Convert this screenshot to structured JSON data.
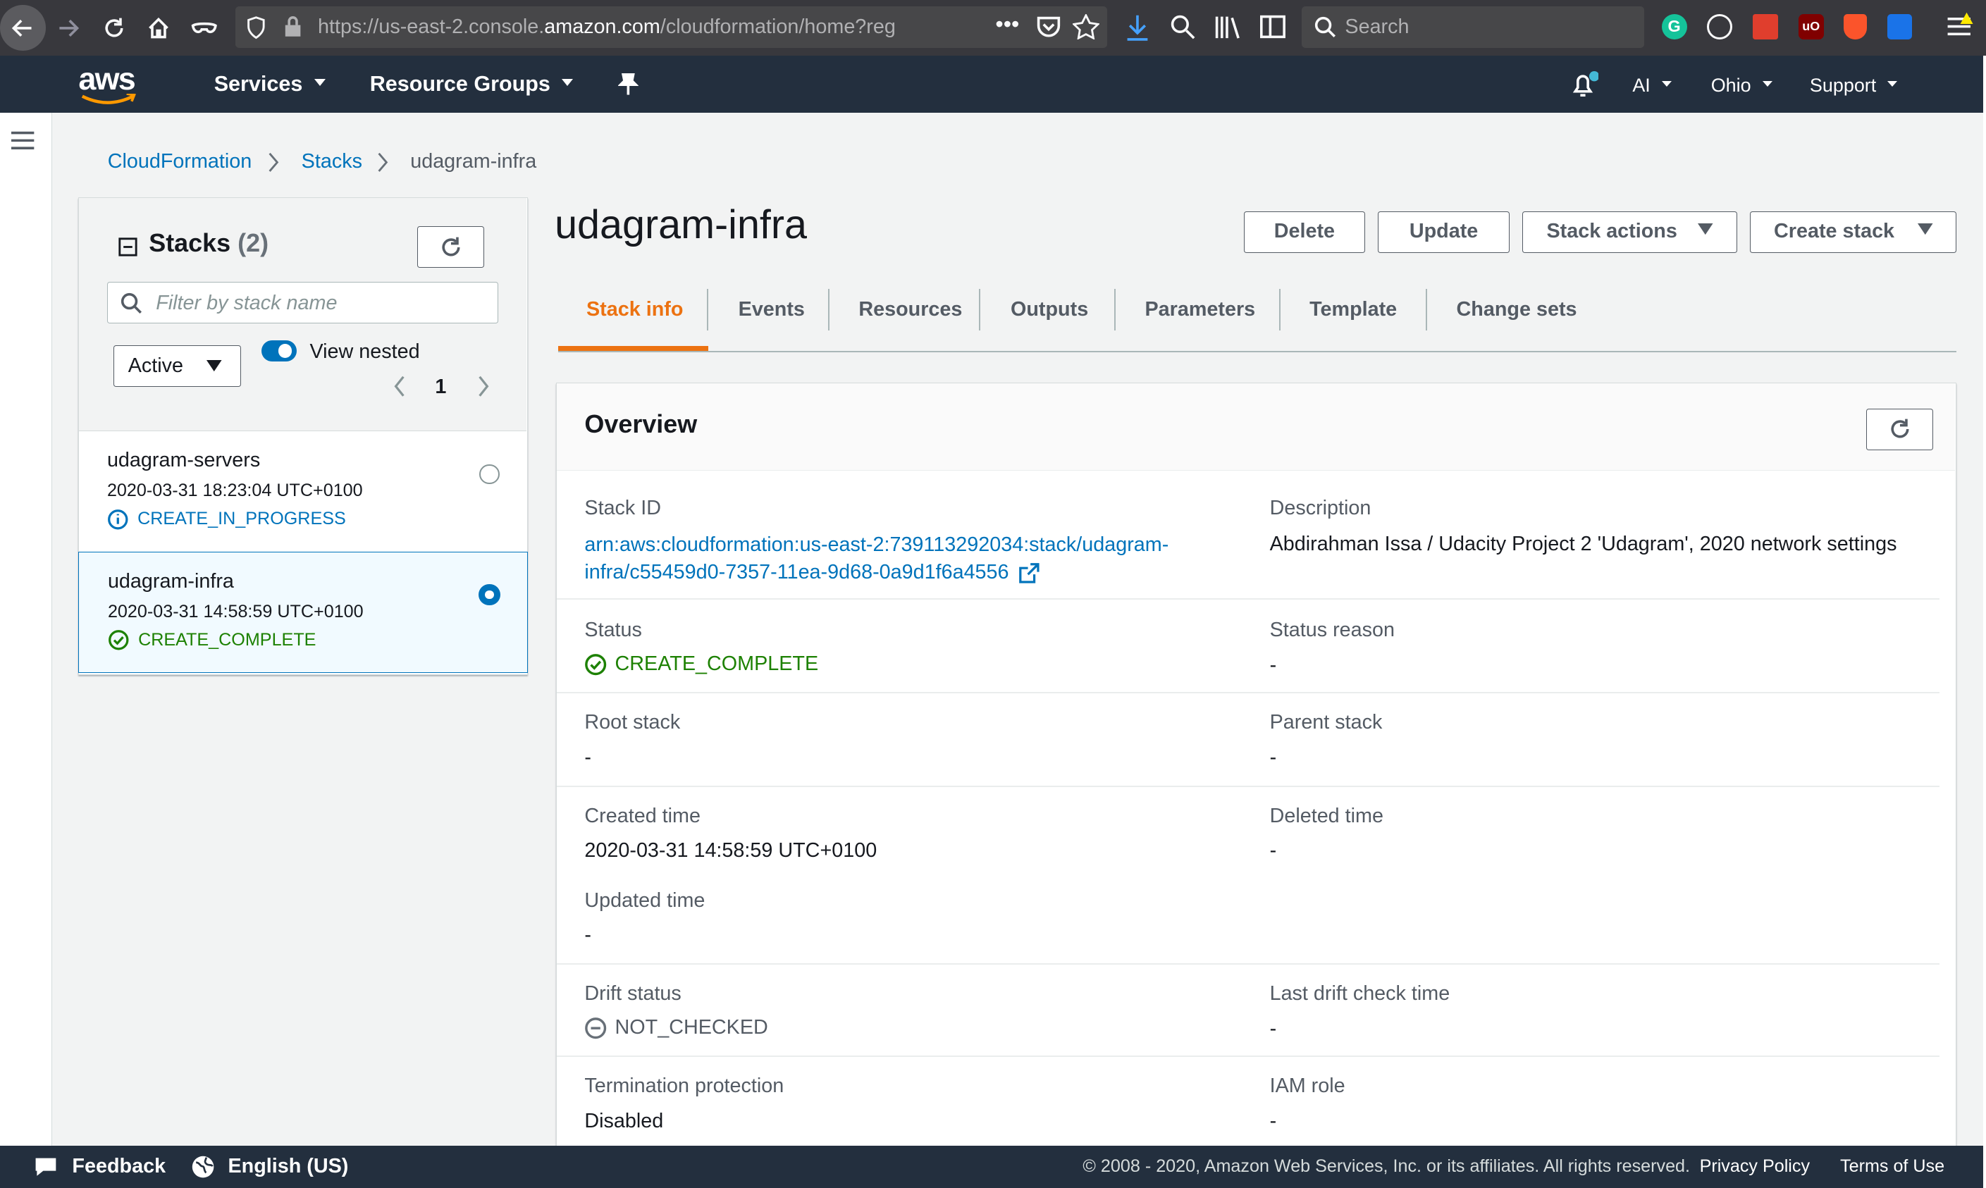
{
  "browser": {
    "url_prefix": "https://us-east-2.console.",
    "url_domain": "amazon.com",
    "url_suffix": "/cloudformation/home?reg",
    "search_placeholder": "Search"
  },
  "nav": {
    "logo": "aws",
    "services": "Services",
    "resource_groups": "Resource Groups",
    "account": "AI",
    "region": "Ohio",
    "support": "Support"
  },
  "breadcrumb": [
    "CloudFormation",
    "Stacks",
    "udagram-infra"
  ],
  "stacks_panel": {
    "title": "Stacks",
    "count": "(2)",
    "filter_placeholder": "Filter by stack name",
    "filter_select": "Active",
    "view_nested_label": "View nested",
    "view_nested_on": true,
    "page": "1",
    "items": [
      {
        "name": "udagram-servers",
        "date": "2020-03-31 18:23:04 UTC+0100",
        "status": "CREATE_IN_PROGRESS",
        "selected": false
      },
      {
        "name": "udagram-infra",
        "date": "2020-03-31 14:58:59 UTC+0100",
        "status": "CREATE_COMPLETE",
        "selected": true
      }
    ]
  },
  "stack": {
    "title": "udagram-infra",
    "buttons": {
      "delete": "Delete",
      "update": "Update",
      "actions": "Stack actions",
      "create": "Create stack"
    },
    "tabs": [
      "Stack info",
      "Events",
      "Resources",
      "Outputs",
      "Parameters",
      "Template",
      "Change sets"
    ],
    "active_tab": "Stack info"
  },
  "overview": {
    "title": "Overview",
    "stack_id_label": "Stack ID",
    "stack_id_line1": "arn:aws:cloudformation:us-east-2:739113292034:stack/udagram-",
    "stack_id_line2": "infra/c55459d0-7357-11ea-9d68-0a9d1f6a4556",
    "description_label": "Description",
    "description": "Abdirahman Issa / Udacity Project 2 'Udagram', 2020 network settings",
    "status_label": "Status",
    "status": "CREATE_COMPLETE",
    "status_reason_label": "Status reason",
    "status_reason": "-",
    "root_stack_label": "Root stack",
    "root_stack": "-",
    "parent_stack_label": "Parent stack",
    "parent_stack": "-",
    "created_label": "Created time",
    "created": "2020-03-31 14:58:59 UTC+0100",
    "deleted_label": "Deleted time",
    "deleted": "-",
    "updated_label": "Updated time",
    "updated": "-",
    "drift_label": "Drift status",
    "drift": "NOT_CHECKED",
    "last_drift_label": "Last drift check time",
    "last_drift": "-",
    "termination_label": "Termination protection",
    "termination": "Disabled",
    "iam_label": "IAM role",
    "iam": "-"
  },
  "footer": {
    "feedback": "Feedback",
    "language": "English (US)",
    "copyright": "© 2008 - 2020, Amazon Web Services, Inc. or its affiliates. All rights reserved.",
    "privacy": "Privacy Policy",
    "terms": "Terms of Use"
  },
  "colors": {
    "nav_bg": "#232f3e",
    "link": "#0073bb",
    "accent_orange": "#ec7211",
    "success": "#1d8102",
    "info": "#0073bb"
  }
}
